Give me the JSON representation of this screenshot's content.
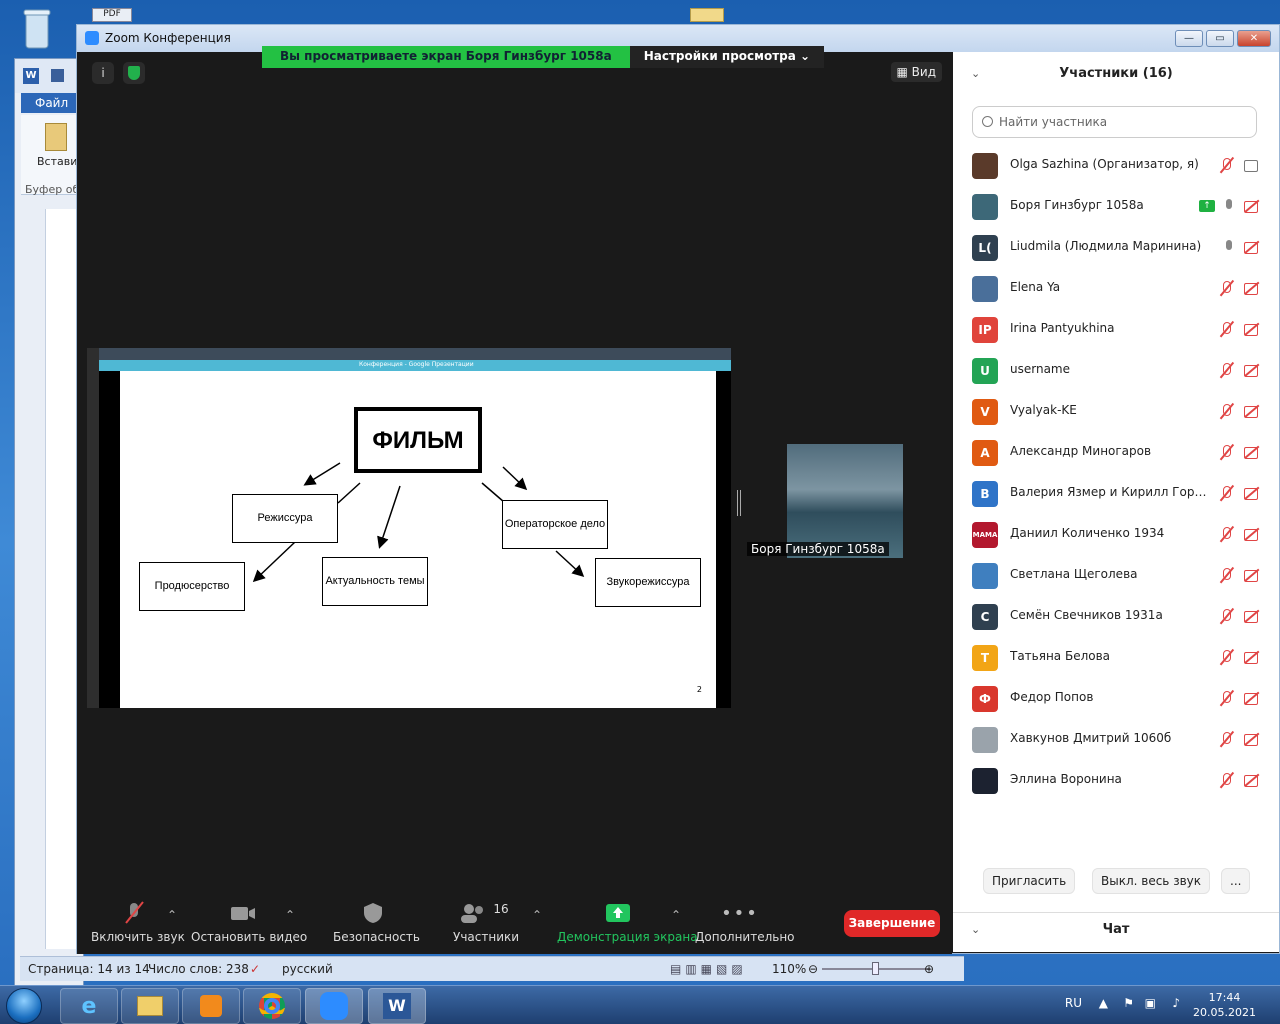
{
  "desktop": {
    "icons": [
      "recycle-bin-icon",
      "pdf-file-icon",
      "folder-icon"
    ]
  },
  "word": {
    "file_tab": "Файл",
    "paste_label": "Вставит",
    "buffer_label": "Буфер об",
    "status": {
      "page": "Страница: 14 из 14",
      "words": "Число слов: 238",
      "language": "русский",
      "zoom": "110%"
    }
  },
  "zoom": {
    "title": "Zoom Конференция",
    "share_banner": "Вы просматриваете экран Боря Гинзбург 1058а",
    "view_options": "Настройки просмотра",
    "view_button": "Вид",
    "info_icon": "i",
    "slide": {
      "url": "Конференция - Google Презентации",
      "title": "ФИЛЬМ",
      "boxes": [
        "Режиссура",
        "Операторское дело",
        "Продюсерство",
        "Актуальность темы",
        "Звукорежиссура"
      ],
      "page_number": "2"
    },
    "thumbnail_name": "Боря Гинзбург 1058а",
    "toolbar": {
      "unmute": "Включить звук",
      "stop_video": "Остановить видео",
      "security": "Безопасность",
      "participants": "Участники",
      "participants_count": "16",
      "share_screen": "Демонстрация экрана",
      "more": "Дополнительно",
      "end": "Завершение"
    }
  },
  "panel": {
    "title": "Участники (16)",
    "search_placeholder": "Найти участника",
    "participants": [
      {
        "name": "Olga Sazhina (Организатор, я)",
        "avatar": "",
        "color": "#5a3a2a",
        "mic": "muted",
        "video": "on"
      },
      {
        "name": "Боря Гинзбург 1058а",
        "avatar": "",
        "color": "#3d6878",
        "mic": "on",
        "video": "off",
        "sharing": true
      },
      {
        "name": "Liudmila (Людмила Маринина)",
        "avatar": "L(",
        "color": "#2f4050",
        "mic": "on",
        "video": "off"
      },
      {
        "name": "Elena Ya",
        "avatar": "",
        "color": "#4a6f9a",
        "mic": "muted",
        "video": "off"
      },
      {
        "name": "Irina Pantyukhina",
        "avatar": "IP",
        "color": "#e0443b",
        "mic": "muted",
        "video": "off"
      },
      {
        "name": "username",
        "avatar": "U",
        "color": "#23a455",
        "mic": "muted",
        "video": "off"
      },
      {
        "name": "Vyalyak-KE",
        "avatar": "V",
        "color": "#e05a12",
        "mic": "muted",
        "video": "off"
      },
      {
        "name": "Александр Миногаров",
        "avatar": "А",
        "color": "#e05a12",
        "mic": "muted",
        "video": "off"
      },
      {
        "name": "Валерия Язмер и Кирилл Горш...",
        "avatar": "В",
        "color": "#2f74c8",
        "mic": "muted",
        "video": "off"
      },
      {
        "name": "Даниил Количенко 1934",
        "avatar": "MAMA",
        "color": "#b3182e",
        "mic": "muted",
        "video": "off"
      },
      {
        "name": "Светлана Щеголева",
        "avatar": "",
        "color": "#3f7fbf",
        "mic": "muted",
        "video": "off"
      },
      {
        "name": "Семён Свечников 1931а",
        "avatar": "С",
        "color": "#2f4050",
        "mic": "muted",
        "video": "off"
      },
      {
        "name": "Татьяна Белова",
        "avatar": "Т",
        "color": "#f2a516",
        "mic": "muted",
        "video": "off"
      },
      {
        "name": "Федор Попов",
        "avatar": "Ф",
        "color": "#d9372d",
        "mic": "muted",
        "video": "off"
      },
      {
        "name": "Хавкунов Дмитрий 1060б",
        "avatar": "",
        "color": "#9aa3ab",
        "mic": "muted",
        "video": "off"
      },
      {
        "name": "Эллина Воронина",
        "avatar": "",
        "color": "#1c2230",
        "mic": "muted",
        "video": "off"
      }
    ],
    "invite": "Пригласить",
    "mute_all": "Выкл. весь звук",
    "more": "...",
    "chat": "Чат"
  },
  "taskbar": {
    "lang": "RU",
    "time": "17:44",
    "date": "20.05.2021"
  }
}
